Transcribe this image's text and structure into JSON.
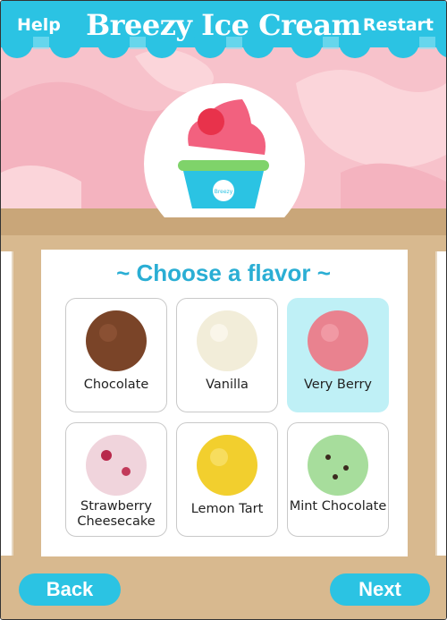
{
  "header": {
    "help_label": "Help",
    "title": "Breezy Ice Cream",
    "restart_label": "Restart"
  },
  "cup": {
    "logo_text": "Breezy"
  },
  "menu": {
    "heading": "~ Choose a flavor ~",
    "flavors": [
      {
        "label": "Chocolate",
        "color": "#7a4428",
        "selected": false
      },
      {
        "label": "Vanilla",
        "color": "#f2edd9",
        "selected": false
      },
      {
        "label": "Very Berry",
        "color": "#e9828f",
        "selected": true
      },
      {
        "label": "Strawberry Cheesecake",
        "color": "#f0d4dc",
        "selected": false
      },
      {
        "label": "Lemon Tart",
        "color": "#f2cf2e",
        "selected": false
      },
      {
        "label": "Mint Chocolate",
        "color": "#a7dd9c",
        "selected": false
      }
    ]
  },
  "footer": {
    "back_label": "Back",
    "next_label": "Next"
  },
  "colors": {
    "accent": "#2bc3e3",
    "heading": "#2aaed4",
    "selected_tile": "#bff0f6"
  }
}
